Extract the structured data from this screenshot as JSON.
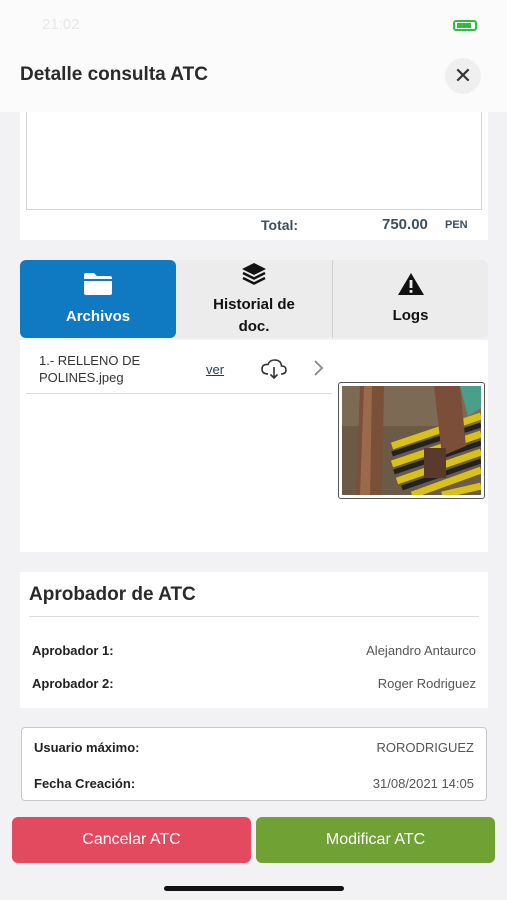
{
  "status_bar": {
    "time": "21:02"
  },
  "header": {
    "title": "Detalle consulta ATC"
  },
  "totals": {
    "label": "Total:",
    "value": "750.00",
    "currency": "PEN"
  },
  "tabs": [
    {
      "label": "Archivos",
      "icon": "folder-icon",
      "active": true
    },
    {
      "label": "Historial de doc.",
      "icon": "layers-icon",
      "active": false
    },
    {
      "label": "Logs",
      "icon": "warning-icon",
      "active": false
    }
  ],
  "files": [
    {
      "name": "1.- RELLENO DE POLINES.jpeg",
      "view_label": "ver"
    }
  ],
  "approvers": {
    "title": "Aprobador de ATC",
    "rows": [
      {
        "label": "Aprobador 1:",
        "value": "Alejandro Antaurco"
      },
      {
        "label": "Aprobador 2:",
        "value": "Roger Rodriguez"
      }
    ]
  },
  "meta": {
    "rows": [
      {
        "label": "Usuario máximo:",
        "value": "RORODRIGUEZ"
      },
      {
        "label": "Fecha Creación:",
        "value": "31/08/2021 14:05"
      }
    ]
  },
  "actions": {
    "cancel_label": "Cancelar ATC",
    "modify_label": "Modificar ATC"
  },
  "colors": {
    "primary": "#0f79c1",
    "cancel": "#e34a5f",
    "modify": "#6fa134"
  }
}
